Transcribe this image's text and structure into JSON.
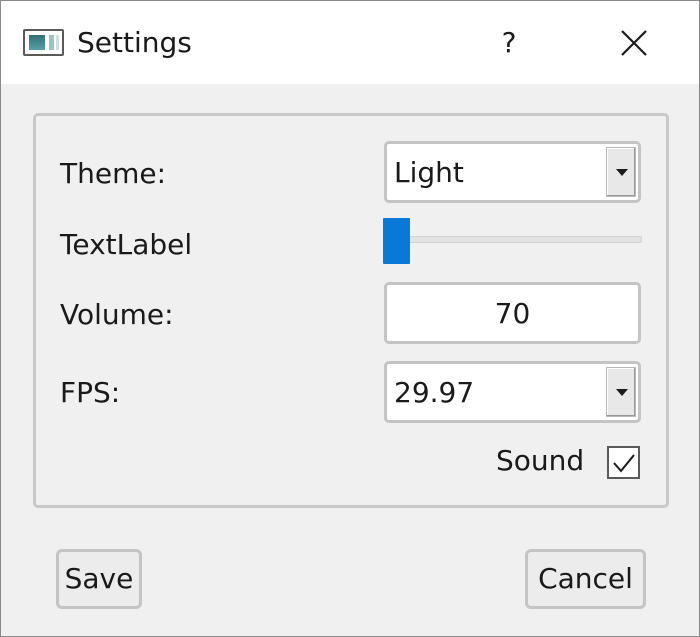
{
  "window": {
    "title": "Settings",
    "help_label": "?",
    "icons": {
      "app": "app-window-icon",
      "close": "close-icon"
    }
  },
  "form": {
    "theme": {
      "label": "Theme:",
      "value": "Light"
    },
    "text_label": {
      "label": "TextLabel",
      "slider_value": 0
    },
    "volume": {
      "label": "Volume:",
      "value": "70"
    },
    "fps": {
      "label": "FPS:",
      "value": "29.97"
    },
    "sound": {
      "label": "Sound",
      "checked": true
    }
  },
  "buttons": {
    "save": "Save",
    "cancel": "Cancel"
  },
  "colors": {
    "accent": "#0a78d7",
    "frame": "#c4c4c4",
    "background": "#f0f0f0"
  }
}
